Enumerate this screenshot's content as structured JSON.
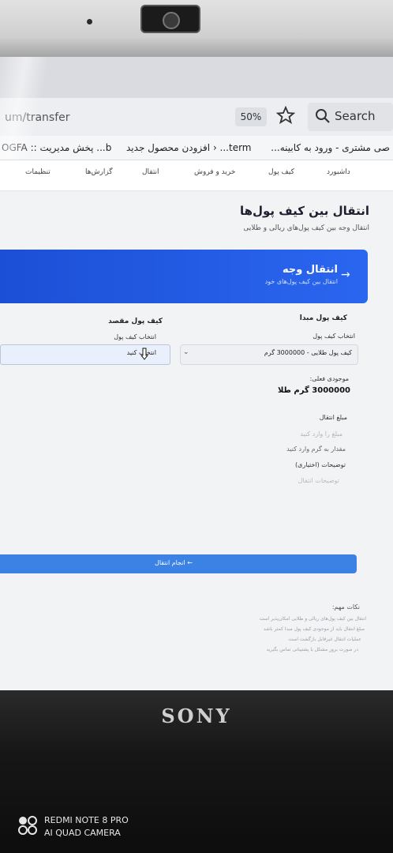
{
  "browser": {
    "url": "um/transfer",
    "zoom": "50%",
    "search_label": "Search",
    "bookmarks": [
      "صی مشتری - ورود به کابینه...",
      "term... ‹ افزودن محصول جدید",
      "b... پخش مدیریت :: OGFA"
    ]
  },
  "nav": {
    "items": [
      "داشبورد",
      "کیف پول",
      "خرید و فروش",
      "انتقال",
      "گزارش‌ها",
      "تنظیمات"
    ]
  },
  "page": {
    "title": "انتقال بین کیف پول‌ها",
    "subtitle": "انتقال وجه بین کیف پول‌های ریالی و طلایی"
  },
  "banner": {
    "title": "انتقال وجه",
    "subtitle": "انتقال بین کیف پول‌های خود"
  },
  "source": {
    "header": "کیف پول مبدا",
    "select_label": "انتخاب کیف پول",
    "selected": "کیف پول طلایی - 3000000 گرم",
    "balance_label": "موجودی فعلی:",
    "balance_value": "3000000 گرم طلا"
  },
  "destination": {
    "header": "کیف پول مقصد",
    "select_label": "انتخاب کیف پول",
    "selected": "انتخاب کنید"
  },
  "amount": {
    "label": "مبلغ انتقال",
    "placeholder": "مبلغ را وارد کنید",
    "hint": "مقدار به گرم وارد کنید"
  },
  "description": {
    "label": "توضیحات (اختیاری)",
    "placeholder": "توضیحات انتقال"
  },
  "submit_label": "انجام انتقال",
  "notes": {
    "title": "نکات مهم:",
    "items": [
      "انتقال بین کیف پول‌های ریالی و طلایی امکان‌پذیر است",
      "مبلغ انتقال باید از موجودی کیف پول مبدا کمتر باشد",
      "عملیات انتقال غیرقابل بازگشت است",
      "در صورت بروز مشکل با پشتیبانی تماس بگیرید"
    ]
  },
  "device": {
    "laptop_brand": "SONY",
    "watermark_line1": "REDMI NOTE 8 PRO",
    "watermark_line2": "AI QUAD CAMERA"
  }
}
